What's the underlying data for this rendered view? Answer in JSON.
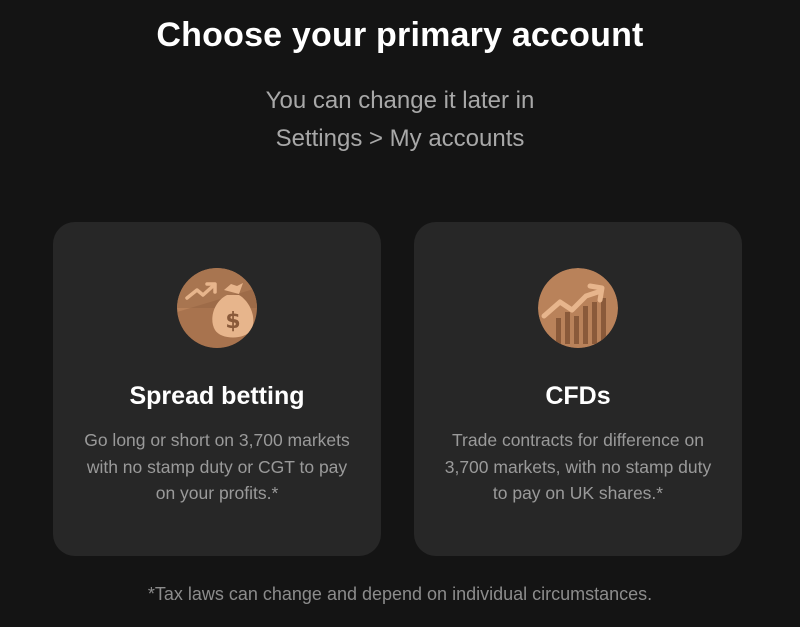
{
  "header": {
    "title": "Choose your primary account",
    "subtitle_line1": "You can change it later in",
    "subtitle_line2": "Settings > My accounts"
  },
  "cards": [
    {
      "icon": "money-bag-trend-icon",
      "title": "Spread betting",
      "description": "Go long or short on 3,700 markets with no stamp duty or CGT to pay on your profits.*"
    },
    {
      "icon": "bar-chart-trend-icon",
      "title": "CFDs",
      "description": "Trade contracts for difference on 3,700 markets, with no stamp duty to pay on UK shares.*"
    }
  ],
  "footnote": "*Tax laws can change and depend on individual circumstances.",
  "colors": {
    "background": "#141414",
    "card": "#272727",
    "icon_bg": "#b9825a",
    "icon_light": "#e7b58c",
    "icon_dark": "#8a5a3a"
  }
}
